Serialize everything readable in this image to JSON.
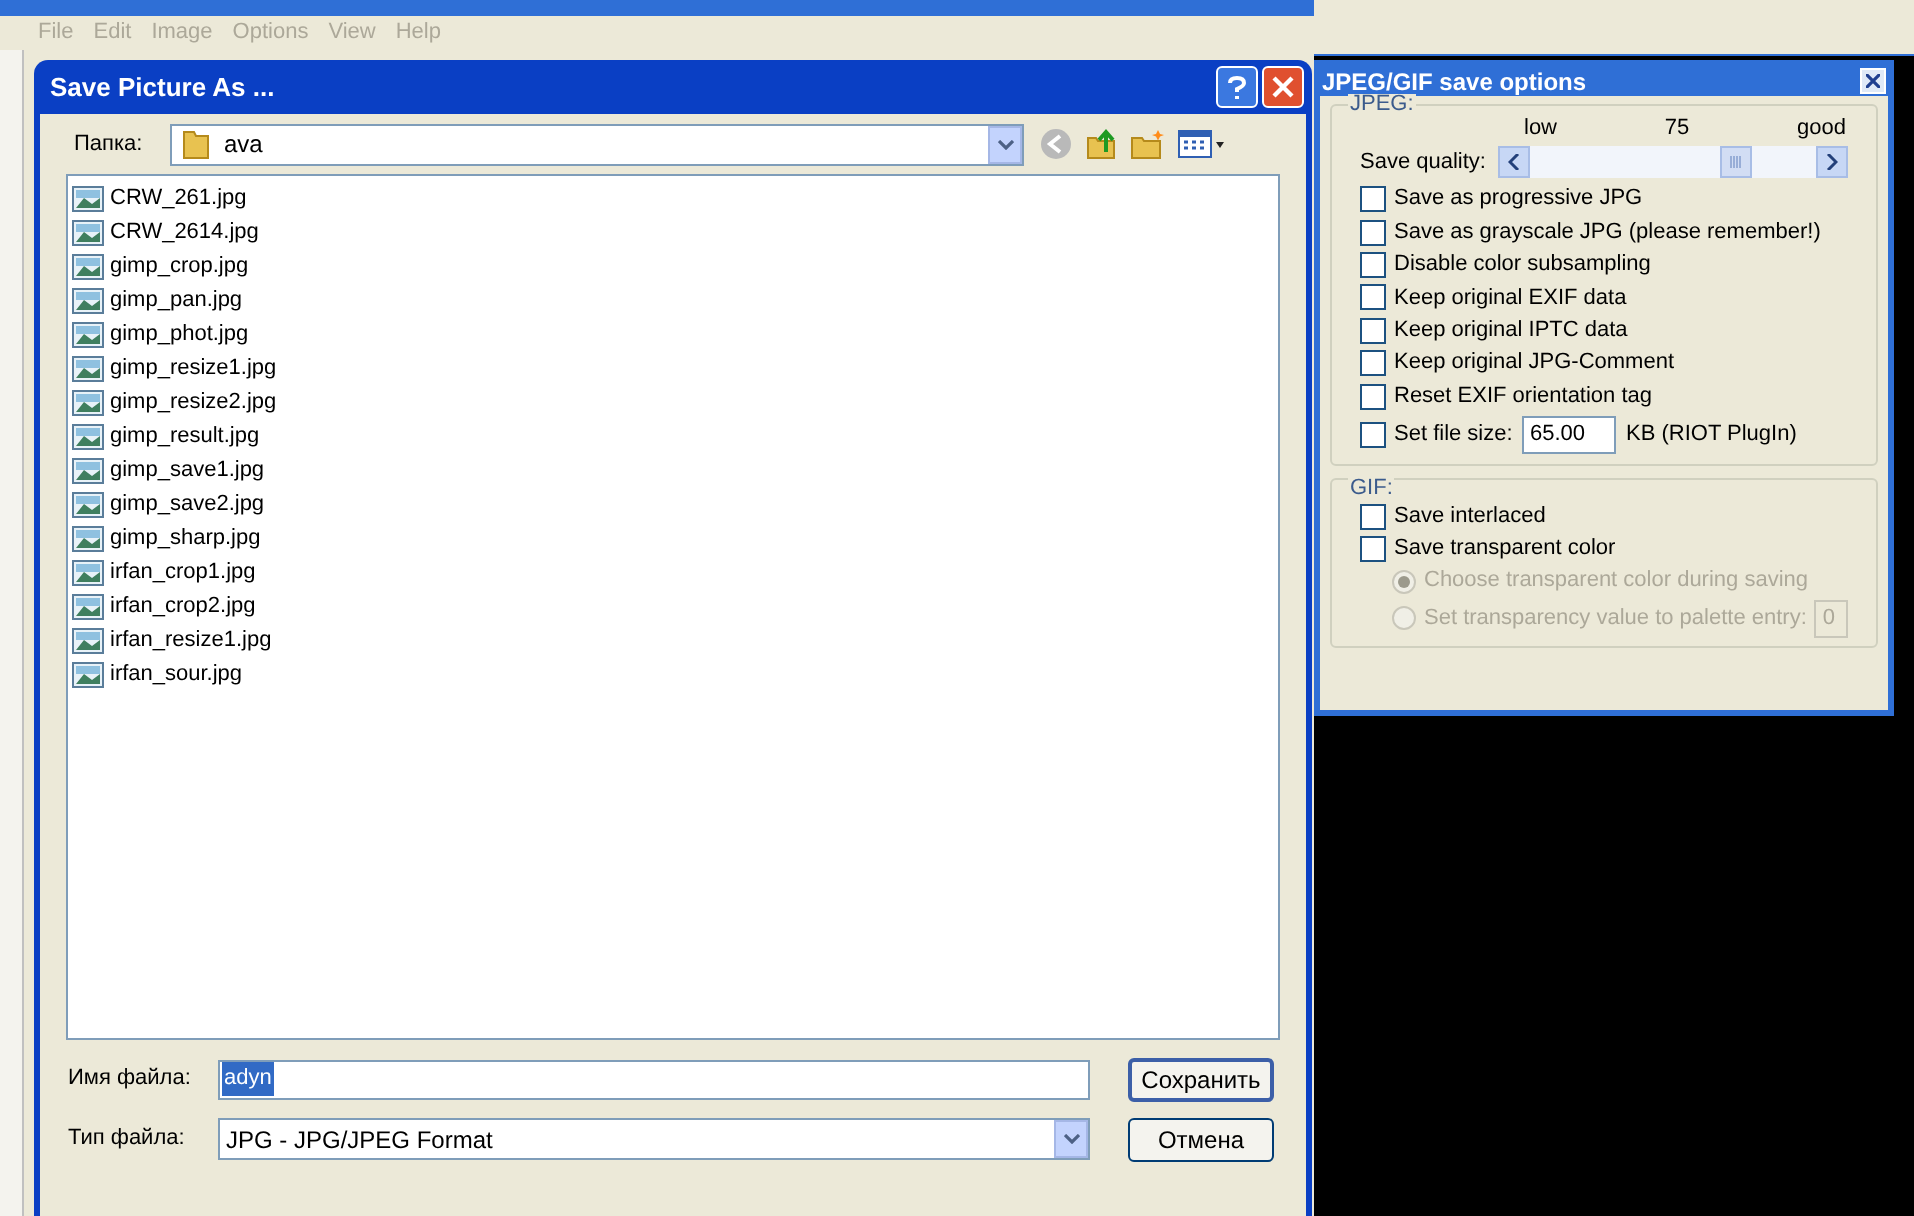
{
  "menu_bar": [
    "File",
    "Edit",
    "Image",
    "Options",
    "View",
    "Help"
  ],
  "save_dialog": {
    "title": "Save Picture As ...",
    "folder_label": "Папка:",
    "folder": "ava",
    "files": [
      "CRW_261.jpg",
      "CRW_2614.jpg",
      "gimp_crop.jpg",
      "gimp_pan.jpg",
      "gimp_phot.jpg",
      "gimp_resize1.jpg",
      "gimp_resize2.jpg",
      "gimp_result.jpg",
      "gimp_save1.jpg",
      "gimp_save2.jpg",
      "gimp_sharp.jpg",
      "irfan_crop1.jpg",
      "irfan_crop2.jpg",
      "irfan_resize1.jpg",
      "irfan_sour.jpg"
    ],
    "filename_label": "Имя файла:",
    "filename": "adyn",
    "filetype_label": "Тип файла:",
    "filetype": "JPG - JPG/JPEG Format",
    "buttons": [
      "Сохранить",
      "Отмена"
    ]
  },
  "options_panel": {
    "title": "JPEG/GIF save options",
    "jpeg": {
      "label": "JPEG:",
      "quality_label": "Save quality:",
      "low": "low",
      "reading": "75",
      "good": "good",
      "level": 0.75,
      "options": [
        {
          "kind": "checkbox",
          "label": "Save as progressive JPG",
          "checked": false
        },
        {
          "kind": "checkbox",
          "label": "Save as grayscale JPG (please remember!)",
          "checked": false
        },
        {
          "kind": "checkbox",
          "label": "Disable color subsampling",
          "checked": false
        },
        {
          "kind": "checkbox",
          "label": "Keep original EXIF data",
          "checked": false
        },
        {
          "kind": "checkbox",
          "label": "Keep original IPTC data",
          "checked": false
        },
        {
          "kind": "checkbox",
          "label": "Keep original JPG-Comment",
          "checked": false
        },
        {
          "kind": "checkbox",
          "label": "Reset EXIF orientation tag",
          "checked": false
        },
        {
          "kind": "size",
          "label": "Set file size:",
          "checked": false,
          "value": "65.00",
          "unit": "KB (RIOT PlugIn)"
        }
      ]
    },
    "gif": {
      "label": "GIF:",
      "options": [
        {
          "label": "Save interlaced",
          "checked": false
        },
        {
          "label": "Save transparent color",
          "checked": false
        }
      ],
      "radios": [
        {
          "label": "Choose transparent color during saving",
          "selected": true,
          "disabled": true
        },
        {
          "label": "Set transparency value to palette entry:",
          "selected": false,
          "disabled": true,
          "value": "0"
        }
      ]
    }
  }
}
